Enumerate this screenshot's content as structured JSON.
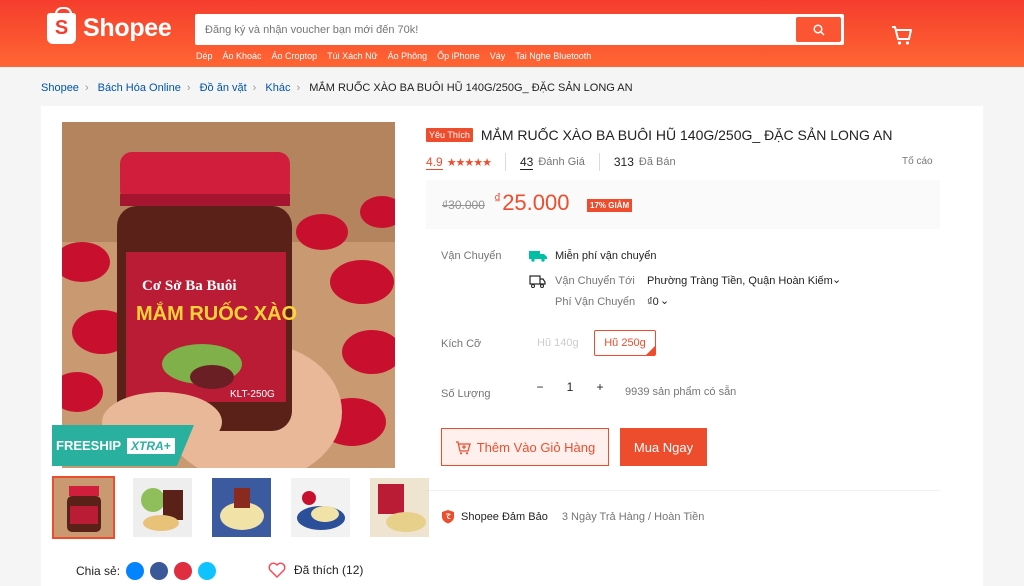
{
  "header": {
    "logo_text": "Shopee",
    "logo_glyph": "S",
    "search_placeholder": "Đăng ký và nhận voucher bạn mới đến 70k!",
    "quick_links": [
      "Dép",
      "Áo Khoác",
      "Áo Croptop",
      "Túi Xách Nữ",
      "Áo Phông",
      "Ốp iPhone",
      "Váy",
      "Tai Nghe Bluetooth"
    ]
  },
  "breadcrumb": [
    "Shopee",
    "Bách Hóa Online",
    "Đồ ăn vặt",
    "Khác"
  ],
  "breadcrumb_current": "MẮM RUỐC XÀO BA BUÔI HŨ 140G/250G_ ĐẶC SẢN LONG AN",
  "product": {
    "badge": "Yêu Thích",
    "title": "MẮM RUỐC XÀO BA BUÔI HŨ 140G/250G_ ĐẶC SẢN LONG AN",
    "rating": "4.9",
    "rating_stars": 5,
    "reviews_count": "43",
    "reviews_label": "Đánh Giá",
    "sold_count": "313",
    "sold_label": "Đã Bán",
    "report": "Tố cáo",
    "old_price": "₫30.000",
    "currency": "₫",
    "new_price": "25.000",
    "discount": "17% GIẢM"
  },
  "shipping": {
    "label": "Vận Chuyển",
    "free": "Miễn phí vận chuyển",
    "to_label": "Vận Chuyển Tới",
    "to_value": "Phường Tràng Tiền, Quận Hoàn Kiếm",
    "fee_label": "Phí Vận Chuyển",
    "fee_value": "₫0"
  },
  "variants": {
    "label": "Kích Cỡ",
    "options": [
      "Hũ 140g",
      "Hũ 250g"
    ]
  },
  "quantity": {
    "label": "Số Lượng",
    "minus": "−",
    "value": "1",
    "plus": "+",
    "stock": "9939 sản phẩm có sẵn"
  },
  "actions": {
    "add_to_cart": "Thêm Vào Giỏ Hàng",
    "buy_now": "Mua Ngay"
  },
  "guarantee": {
    "label": "Shopee Đảm Bảo",
    "desc": "3 Ngày Trả Hàng / Hoàn Tiền"
  },
  "image": {
    "freeship": "FREESHIP",
    "xtra": "XTRA+",
    "jar_brand": "Cơ Sở Ba Buôi",
    "jar_product": "MẮM RUỐC XÀO",
    "jar_code": "KLT-250G"
  },
  "social": {
    "share_label": "Chia sẻ:",
    "liked": "Đã thích (12)"
  },
  "colors": {
    "brand": "#ee4d2d",
    "header_start": "#f53d2d",
    "header_end": "#ff6633",
    "freeship": "#2ab09f"
  }
}
